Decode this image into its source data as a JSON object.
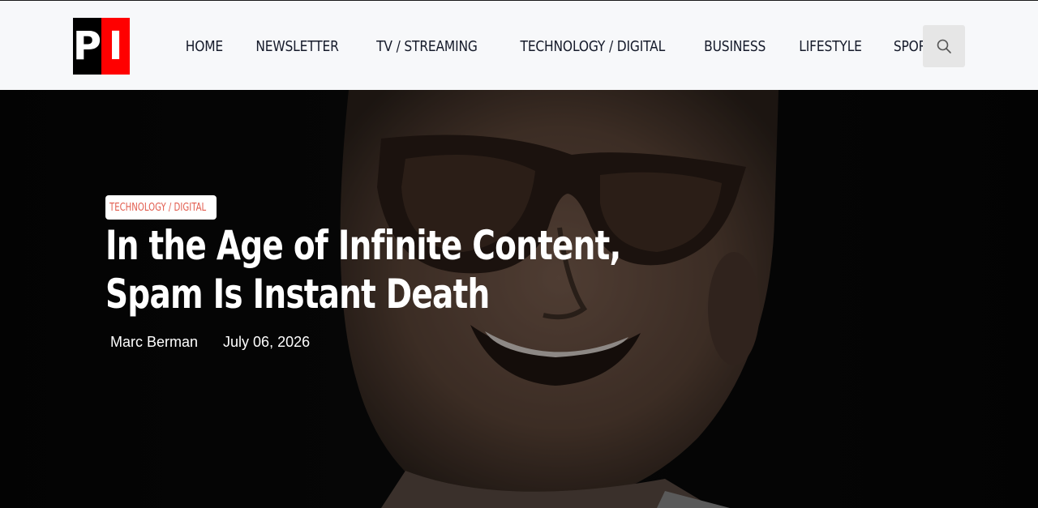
{
  "header": {
    "logo_left": "P",
    "logo_right": "I",
    "nav": [
      "HOME",
      "NEWSLETTER",
      "TV / STREAMING",
      "TECHNOLOGY / DIGITAL",
      "BUSINESS",
      "LIFESTYLE",
      "SPORTS"
    ],
    "search_icon": "search-icon"
  },
  "article": {
    "category": "TECHNOLOGY / DIGITAL",
    "title": "In the Age of Infinite Content, Spam Is Instant Death",
    "author": "Marc Berman",
    "date": "July 06, 2026"
  },
  "colors": {
    "header_bg": "#f7f8fa",
    "nav_text": "#151a2a",
    "logo_red": "#ff0000",
    "category_text": "#e25c4e",
    "hero_bg": "#080808"
  }
}
